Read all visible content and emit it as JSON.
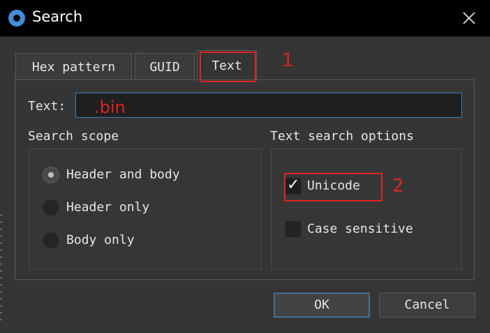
{
  "window": {
    "title": "Search",
    "app_icon": "gear-app-icon",
    "close_icon": "close-icon"
  },
  "tabs": [
    {
      "label": "Hex pattern",
      "active": false
    },
    {
      "label": "GUID",
      "active": false
    },
    {
      "label": "Text",
      "active": true
    }
  ],
  "text_field": {
    "label": "Text:",
    "value": ".bin"
  },
  "search_scope": {
    "title": "Search scope",
    "options": [
      {
        "label": "Header and body",
        "checked": true
      },
      {
        "label": "Header only",
        "checked": false
      },
      {
        "label": "Body only",
        "checked": false
      }
    ]
  },
  "text_options": {
    "title": "Text search options",
    "options": [
      {
        "label": "Unicode",
        "checked": true
      },
      {
        "label": "Case sensitive",
        "checked": false
      }
    ]
  },
  "buttons": {
    "ok": "OK",
    "cancel": "Cancel"
  },
  "annotations": {
    "one": "1",
    "two": "2",
    "color": "#e02424"
  }
}
